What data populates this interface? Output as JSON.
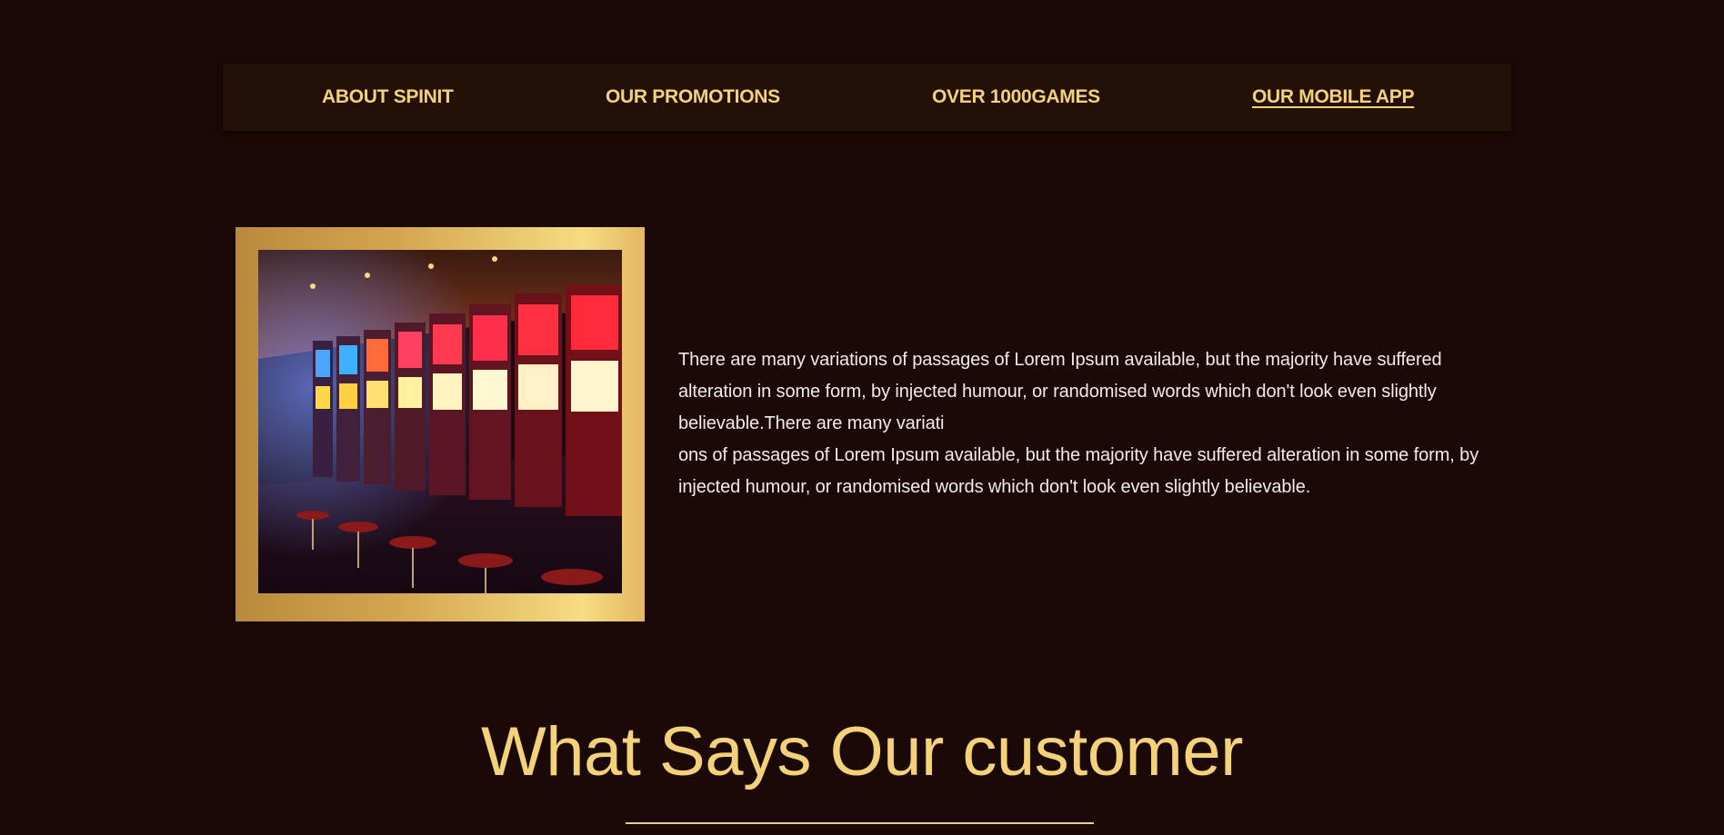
{
  "nav": {
    "items": [
      {
        "label": "ABOUT SPINIT",
        "active": false
      },
      {
        "label": "OUR PROMOTIONS",
        "active": false
      },
      {
        "label": "OVER 1000GAMES",
        "active": false
      },
      {
        "label": "OUR MOBILE APP",
        "active": true
      }
    ]
  },
  "about": {
    "paragraph_1": "There are many variations of passages of Lorem Ipsum available, but the majority have suffered alteration in some form, by injected humour, or randomised words which don't look even slightly believable.There are many variati",
    "paragraph_2": "ons of passages of Lorem Ipsum available, but the majority have suffered alteration in some form, by injected humour, or randomised words which don't look even slightly believable."
  },
  "testimonials": {
    "title": "What Says Our customer"
  },
  "colors": {
    "background": "#1a0906",
    "nav_background": "#220f05",
    "accent_gold": "#f3d27a",
    "body_text": "#f2ece6"
  }
}
